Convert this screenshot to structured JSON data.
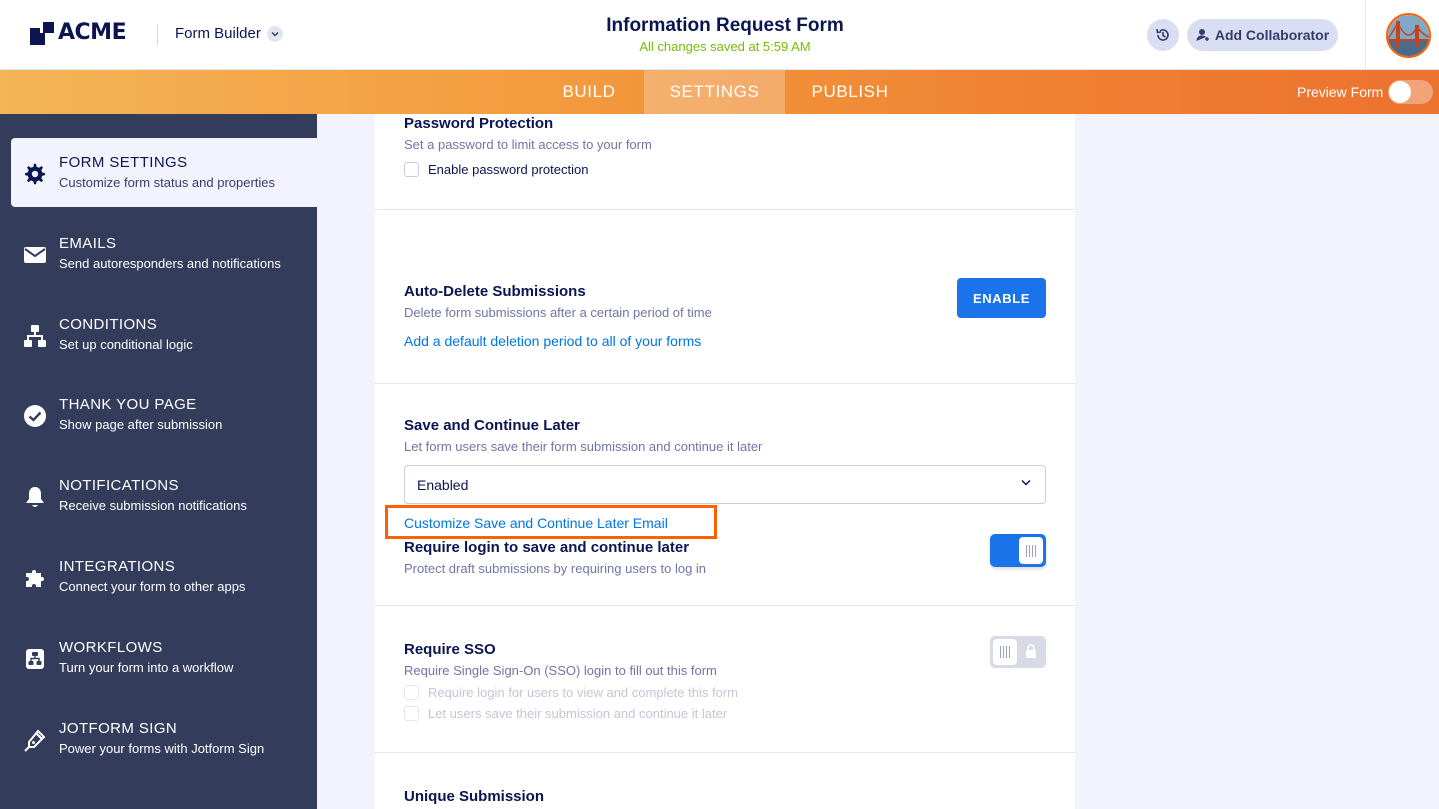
{
  "header": {
    "logo_text": "ACME",
    "app_name": "Form Builder",
    "form_title": "Information Request Form",
    "saved_status": "All changes saved at 5:59 AM",
    "add_collaborator_label": "Add Collaborator"
  },
  "nav": {
    "tabs": [
      {
        "label": "BUILD",
        "active": false
      },
      {
        "label": "SETTINGS",
        "active": true
      },
      {
        "label": "PUBLISH",
        "active": false
      }
    ],
    "preview_label": "Preview Form"
  },
  "sidebar": {
    "items": [
      {
        "title": "FORM SETTINGS",
        "subtitle": "Customize form status and properties",
        "icon": "gear-icon",
        "active": true
      },
      {
        "title": "EMAILS",
        "subtitle": "Send autoresponders and notifications",
        "icon": "envelope-icon"
      },
      {
        "title": "CONDITIONS",
        "subtitle": "Set up conditional logic",
        "icon": "sitemap-icon"
      },
      {
        "title": "THANK YOU PAGE",
        "subtitle": "Show page after submission",
        "icon": "check-circle-icon"
      },
      {
        "title": "NOTIFICATIONS",
        "subtitle": "Receive submission notifications",
        "icon": "bell-icon"
      },
      {
        "title": "INTEGRATIONS",
        "subtitle": "Connect your form to other apps",
        "icon": "puzzle-icon"
      },
      {
        "title": "WORKFLOWS",
        "subtitle": "Turn your form into a workflow",
        "icon": "workflow-icon"
      },
      {
        "title": "JOTFORM SIGN",
        "subtitle": "Power your forms with Jotform Sign",
        "icon": "pen-icon"
      }
    ]
  },
  "settings": {
    "password": {
      "title": "Password Protection",
      "description": "Set a password to limit access to your form",
      "checkbox_label": "Enable password protection"
    },
    "auto_delete": {
      "title": "Auto-Delete Submissions",
      "description": "Delete form submissions after a certain period of time",
      "link": "Add a default deletion period to all of your forms",
      "button_label": "ENABLE"
    },
    "save_continue": {
      "title": "Save and Continue Later",
      "description": "Let form users save their form submission and continue it later",
      "select_value": "Enabled",
      "customize_link": "Customize Save and Continue Later Email",
      "require_login_title": "Require login to save and continue later",
      "require_login_description": "Protect draft submissions by requiring users to log in",
      "require_login_enabled": true
    },
    "sso": {
      "title": "Require SSO",
      "description": "Require Single Sign-On (SSO) login to fill out this form",
      "option1": "Require login for users to view and complete this form",
      "option2": "Let users save their submission and continue it later",
      "enabled": false
    },
    "unique": {
      "title": "Unique Submission"
    }
  },
  "colors": {
    "accent_blue": "#1a73e8",
    "link_blue": "#0075e3",
    "highlight_orange": "#ff6100",
    "sidebar_bg": "#343c5c",
    "saved_green": "#78bb07"
  }
}
